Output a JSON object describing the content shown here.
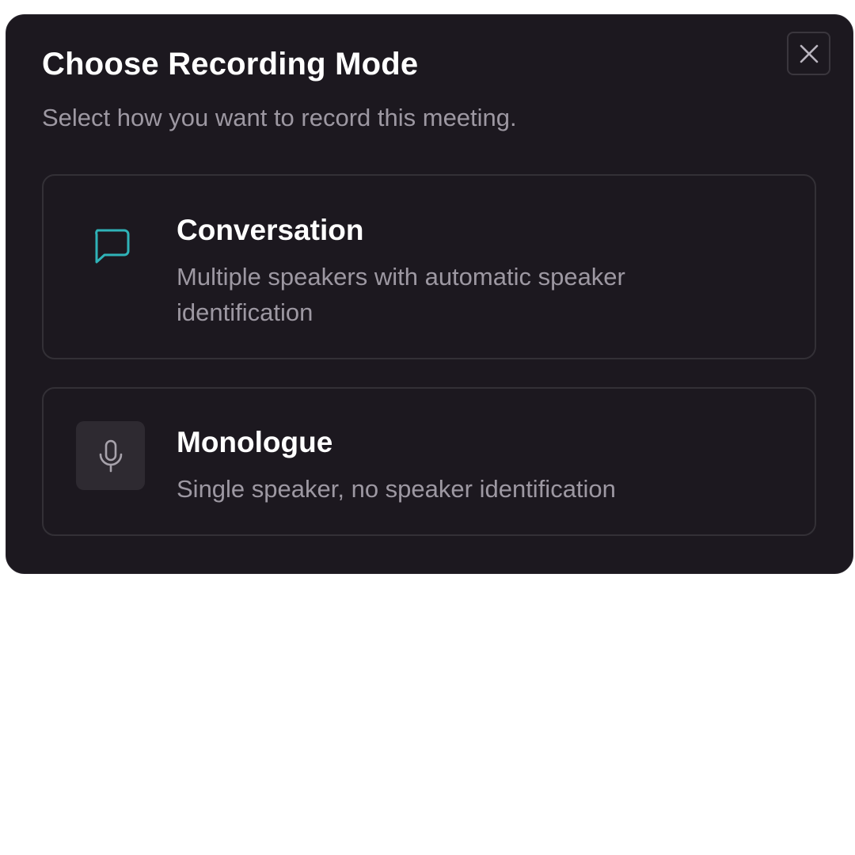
{
  "dialog": {
    "title": "Choose Recording Mode",
    "subtitle": "Select how you want to record this meeting.",
    "close_icon": "close-icon"
  },
  "options": [
    {
      "id": "conversation",
      "icon": "chat-bubble-icon",
      "title": "Conversation",
      "description": "Multiple speakers with automatic speaker identification"
    },
    {
      "id": "monologue",
      "icon": "microphone-icon",
      "title": "Monologue",
      "description": "Single speaker, no speaker identification"
    }
  ],
  "colors": {
    "dialog_background": "#1c181f",
    "accent_teal": "#2fb3b8",
    "text_primary": "#ffffff",
    "text_secondary": "#9d98a2"
  }
}
